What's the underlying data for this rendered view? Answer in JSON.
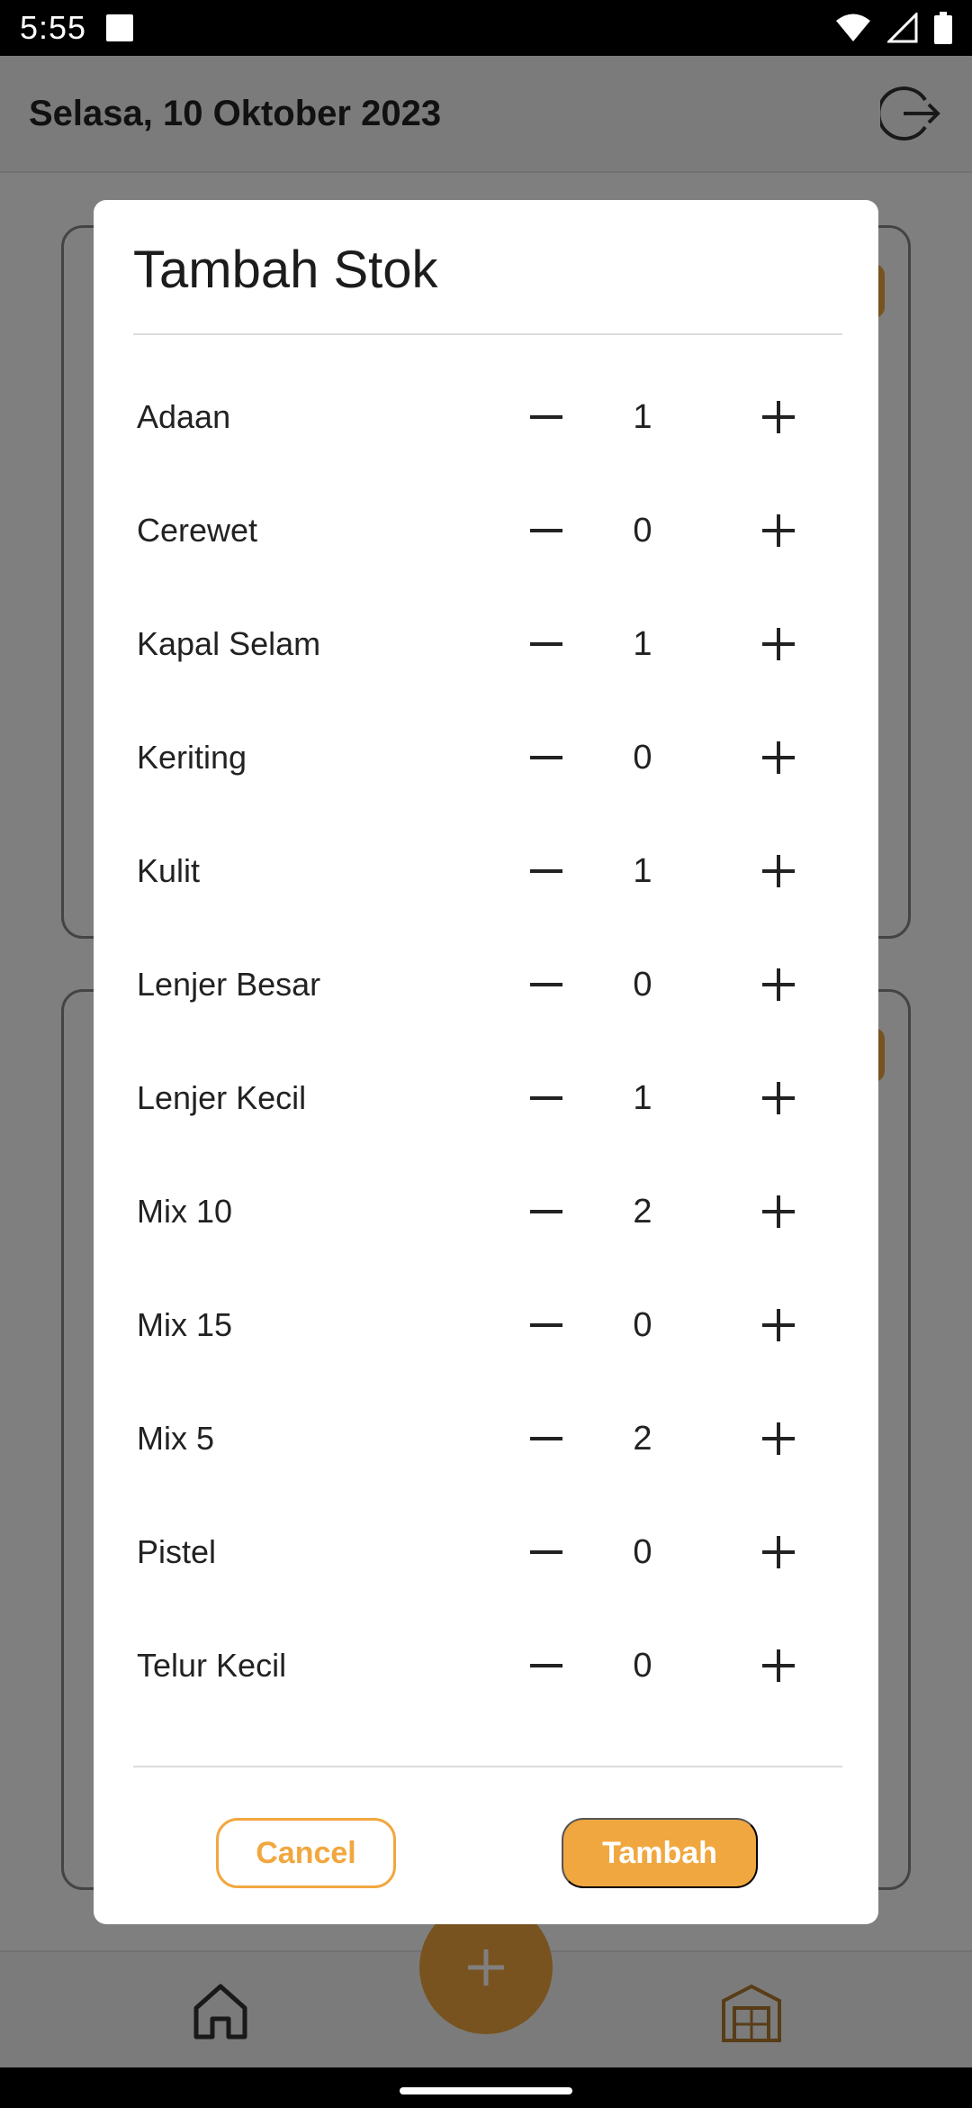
{
  "status_bar": {
    "time": "5:55"
  },
  "header": {
    "date": "Selasa, 10 Oktober 2023"
  },
  "dialog": {
    "title": "Tambah Stok",
    "items": [
      {
        "name": "Adaan",
        "qty": "1"
      },
      {
        "name": "Cerewet",
        "qty": "0"
      },
      {
        "name": "Kapal Selam",
        "qty": "1"
      },
      {
        "name": "Keriting",
        "qty": "0"
      },
      {
        "name": "Kulit",
        "qty": "1"
      },
      {
        "name": "Lenjer Besar",
        "qty": "0"
      },
      {
        "name": "Lenjer Kecil",
        "qty": "1"
      },
      {
        "name": "Mix 10",
        "qty": "2"
      },
      {
        "name": "Mix 15",
        "qty": "0"
      },
      {
        "name": "Mix 5",
        "qty": "2"
      },
      {
        "name": "Pistel",
        "qty": "0"
      },
      {
        "name": "Telur Kecil",
        "qty": "0"
      }
    ],
    "cancel_label": "Cancel",
    "add_label": "Tambah"
  },
  "colors": {
    "accent": "#f1a73f",
    "scrim": "rgba(0,0,0,0.5)"
  },
  "icons": {
    "logout": "logout-icon",
    "minus": "minus-icon",
    "plus": "plus-icon",
    "home": "home-icon",
    "warehouse": "warehouse-icon"
  }
}
